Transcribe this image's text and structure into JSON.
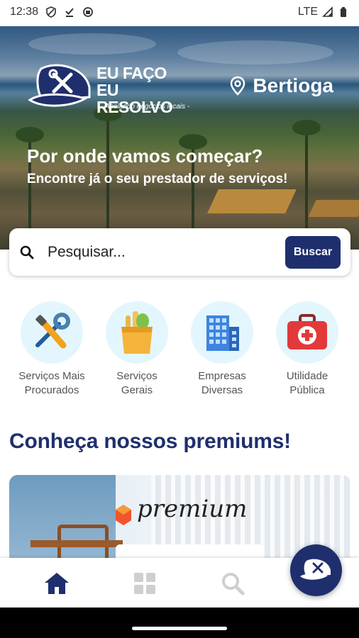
{
  "status_bar": {
    "time": "12:38",
    "network": "LTE",
    "icons": [
      "shield-icon",
      "download-done-icon",
      "sync-icon",
      "signal-icon",
      "battery-icon"
    ]
  },
  "hero": {
    "brand_line1": "EU FAÇO",
    "brand_line2": "EU RESOLVO",
    "brand_tagline": "- Apoiando negócios locais -",
    "city": "Bertioga",
    "title": "Por onde vamos começar?",
    "subtitle": "Encontre já o seu prestador de serviços!"
  },
  "search": {
    "placeholder": "Pesquisar...",
    "button_label": "Buscar"
  },
  "categories": [
    {
      "line1": "Serviços Mais",
      "line2": "Procurados",
      "icon": "tools-icon"
    },
    {
      "line1": "Serviços",
      "line2": "Gerais",
      "icon": "grocery-bag-icon"
    },
    {
      "line1": "Empresas",
      "line2": "Diversas",
      "icon": "buildings-icon"
    },
    {
      "line1": "Utilidade",
      "line2": "Pública",
      "icon": "first-aid-kit-icon"
    }
  ],
  "premium_section": {
    "title": "Conheça nossos premiums!",
    "banner_word": "premium"
  },
  "bottom_nav": {
    "items": [
      "home-icon",
      "grid-icon",
      "search-icon"
    ],
    "active": "home-icon",
    "fab_icon": "cap-tools-icon"
  },
  "colors": {
    "brand_navy": "#1f2f6e",
    "category_circle": "#e3f6fd",
    "category_text": "#555555",
    "inactive_nav": "#cfcfcf"
  }
}
